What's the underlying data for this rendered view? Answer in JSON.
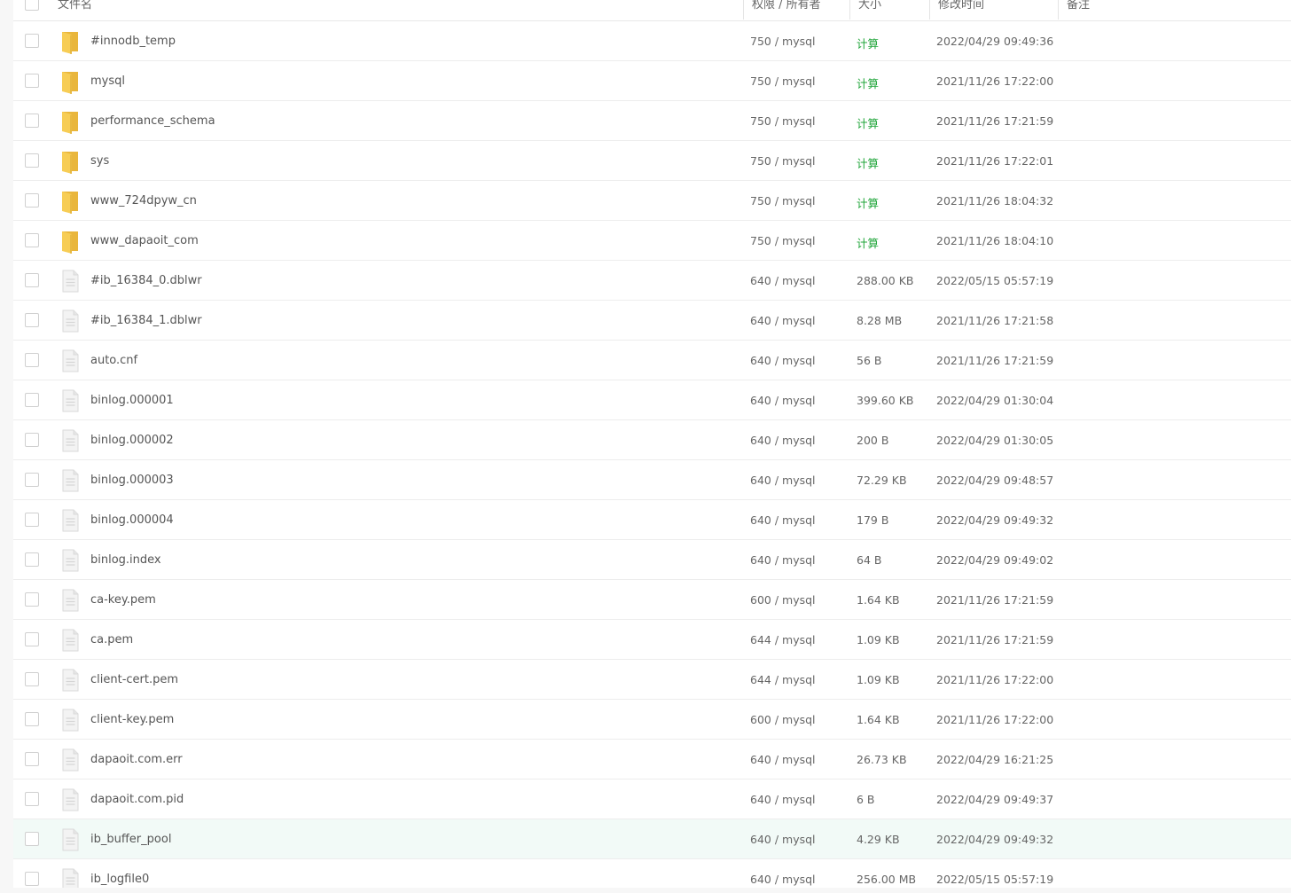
{
  "header": {
    "name": "文件名",
    "perm": "权限 / 所有者",
    "size": "大小",
    "mtime": "修改时间",
    "remark": "备注"
  },
  "rows": [
    {
      "type": "folder",
      "name": "#innodb_temp",
      "perm": "750 / mysql",
      "size": "计算",
      "mtime": "2022/04/29 09:49:36"
    },
    {
      "type": "folder",
      "name": "mysql",
      "perm": "750 / mysql",
      "size": "计算",
      "mtime": "2021/11/26 17:22:00"
    },
    {
      "type": "folder",
      "name": "performance_schema",
      "perm": "750 / mysql",
      "size": "计算",
      "mtime": "2021/11/26 17:21:59"
    },
    {
      "type": "folder",
      "name": "sys",
      "perm": "750 / mysql",
      "size": "计算",
      "mtime": "2021/11/26 17:22:01"
    },
    {
      "type": "folder",
      "name": "www_724dpyw_cn",
      "perm": "750 / mysql",
      "size": "计算",
      "mtime": "2021/11/26 18:04:32"
    },
    {
      "type": "folder",
      "name": "www_dapaoit_com",
      "perm": "750 / mysql",
      "size": "计算",
      "mtime": "2021/11/26 18:04:10"
    },
    {
      "type": "file",
      "name": "#ib_16384_0.dblwr",
      "perm": "640 / mysql",
      "size": "288.00 KB",
      "mtime": "2022/05/15 05:57:19"
    },
    {
      "type": "file",
      "name": "#ib_16384_1.dblwr",
      "perm": "640 / mysql",
      "size": "8.28 MB",
      "mtime": "2021/11/26 17:21:58"
    },
    {
      "type": "file",
      "name": "auto.cnf",
      "perm": "640 / mysql",
      "size": "56 B",
      "mtime": "2021/11/26 17:21:59"
    },
    {
      "type": "file",
      "name": "binlog.000001",
      "perm": "640 / mysql",
      "size": "399.60 KB",
      "mtime": "2022/04/29 01:30:04"
    },
    {
      "type": "file",
      "name": "binlog.000002",
      "perm": "640 / mysql",
      "size": "200 B",
      "mtime": "2022/04/29 01:30:05"
    },
    {
      "type": "file",
      "name": "binlog.000003",
      "perm": "640 / mysql",
      "size": "72.29 KB",
      "mtime": "2022/04/29 09:48:57"
    },
    {
      "type": "file",
      "name": "binlog.000004",
      "perm": "640 / mysql",
      "size": "179 B",
      "mtime": "2022/04/29 09:49:32"
    },
    {
      "type": "file",
      "name": "binlog.index",
      "perm": "640 / mysql",
      "size": "64 B",
      "mtime": "2022/04/29 09:49:02"
    },
    {
      "type": "file",
      "name": "ca-key.pem",
      "perm": "600 / mysql",
      "size": "1.64 KB",
      "mtime": "2021/11/26 17:21:59"
    },
    {
      "type": "file",
      "name": "ca.pem",
      "perm": "644 / mysql",
      "size": "1.09 KB",
      "mtime": "2021/11/26 17:21:59"
    },
    {
      "type": "file",
      "name": "client-cert.pem",
      "perm": "644 / mysql",
      "size": "1.09 KB",
      "mtime": "2021/11/26 17:22:00"
    },
    {
      "type": "file",
      "name": "client-key.pem",
      "perm": "600 / mysql",
      "size": "1.64 KB",
      "mtime": "2021/11/26 17:22:00"
    },
    {
      "type": "file",
      "name": "dapaoit.com.err",
      "perm": "640 / mysql",
      "size": "26.73 KB",
      "mtime": "2022/04/29 16:21:25"
    },
    {
      "type": "file",
      "name": "dapaoit.com.pid",
      "perm": "640 / mysql",
      "size": "6 B",
      "mtime": "2022/04/29 09:49:37"
    },
    {
      "type": "file",
      "name": "ib_buffer_pool",
      "perm": "640 / mysql",
      "size": "4.29 KB",
      "mtime": "2022/04/29 09:49:32",
      "highlighted": true
    },
    {
      "type": "file",
      "name": "ib_logfile0",
      "perm": "640 / mysql",
      "size": "256.00 MB",
      "mtime": "2022/05/15 05:57:19"
    }
  ],
  "colors": {
    "accent_green": "#20a53a",
    "folder_yellow": "#f5c84c",
    "row_highlight": "#f2faf7"
  }
}
